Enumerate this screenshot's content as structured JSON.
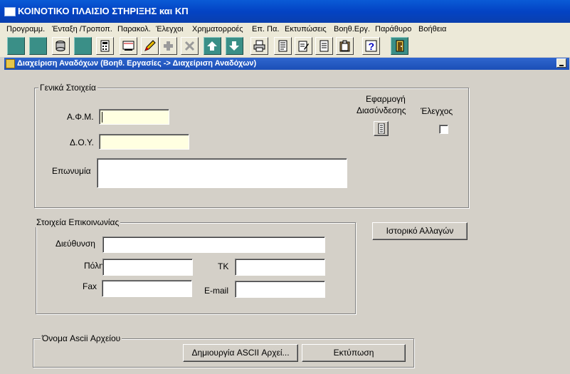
{
  "window": {
    "title": "ΚΟΙΝΟΤΙΚΟ ΠΛΑΙΣΙΟ ΣΤΗΡΙΞΗΣ και ΚΠ"
  },
  "menu": [
    "Προγραμμ.",
    "Ένταξη /Τροποπ.",
    "Παρακολ.",
    "Έλεγχοι",
    "Χρηματορροές",
    "Επ. Πα.",
    "Εκτυπώσεις",
    "Βοηθ.Εργ.",
    "Παράθυρο",
    "Βοήθεια"
  ],
  "toolbar": {
    "icons": [
      "blank-icon",
      "blank-icon",
      "database-icon",
      "blank-icon",
      "calculator-icon",
      "screen-icon",
      "pencil-icon",
      "add-record-icon",
      "delete-record-icon",
      "arrow-up-icon",
      "arrow-down-icon",
      "printer-icon",
      "report-icon",
      "edit-document-icon",
      "document-icon",
      "clipboard-icon",
      "help-icon",
      "exit-door-icon"
    ]
  },
  "subwindow": {
    "title": "Διαχείριση Αναδόχων (Βοηθ. Εργασίες -> Διαχείριση Αναδόχων)"
  },
  "general": {
    "legend": "Γενικά Στοιχεία",
    "afm_label": "Α.Φ.Μ.",
    "afm_value": "",
    "doy_label": "Δ.Ο.Υ.",
    "doy_value": "",
    "eponymia_label": "Επωνυμία",
    "eponymia_value": "",
    "app_link_line1": "Εφαρμογή",
    "app_link_line2": "Διασύνδεσης",
    "check_label": "Έλεγχος",
    "check_value": false
  },
  "history_button": "Ιστορικό Αλλαγών",
  "contact": {
    "legend": "Στοιχεία Επικοινωνίας",
    "address_label": "Διεύθυνση",
    "address_value": "",
    "city_label": "Πόλη",
    "city_value": "",
    "tk_label": "ΤΚ",
    "tk_value": "",
    "fax_label": "Fax",
    "fax_value": "",
    "email_label": "E-mail",
    "email_value": ""
  },
  "ascii": {
    "legend": "Όνομα Ascii Αρχείου",
    "create_button": "Δημιουργία ASCII Αρχεί...",
    "print_button": "Εκτύπωση"
  },
  "colors": {
    "titlebar": "#0a5bd6",
    "toolbar_teal": "#3a8f87",
    "highlight_input": "#ffffe1"
  }
}
